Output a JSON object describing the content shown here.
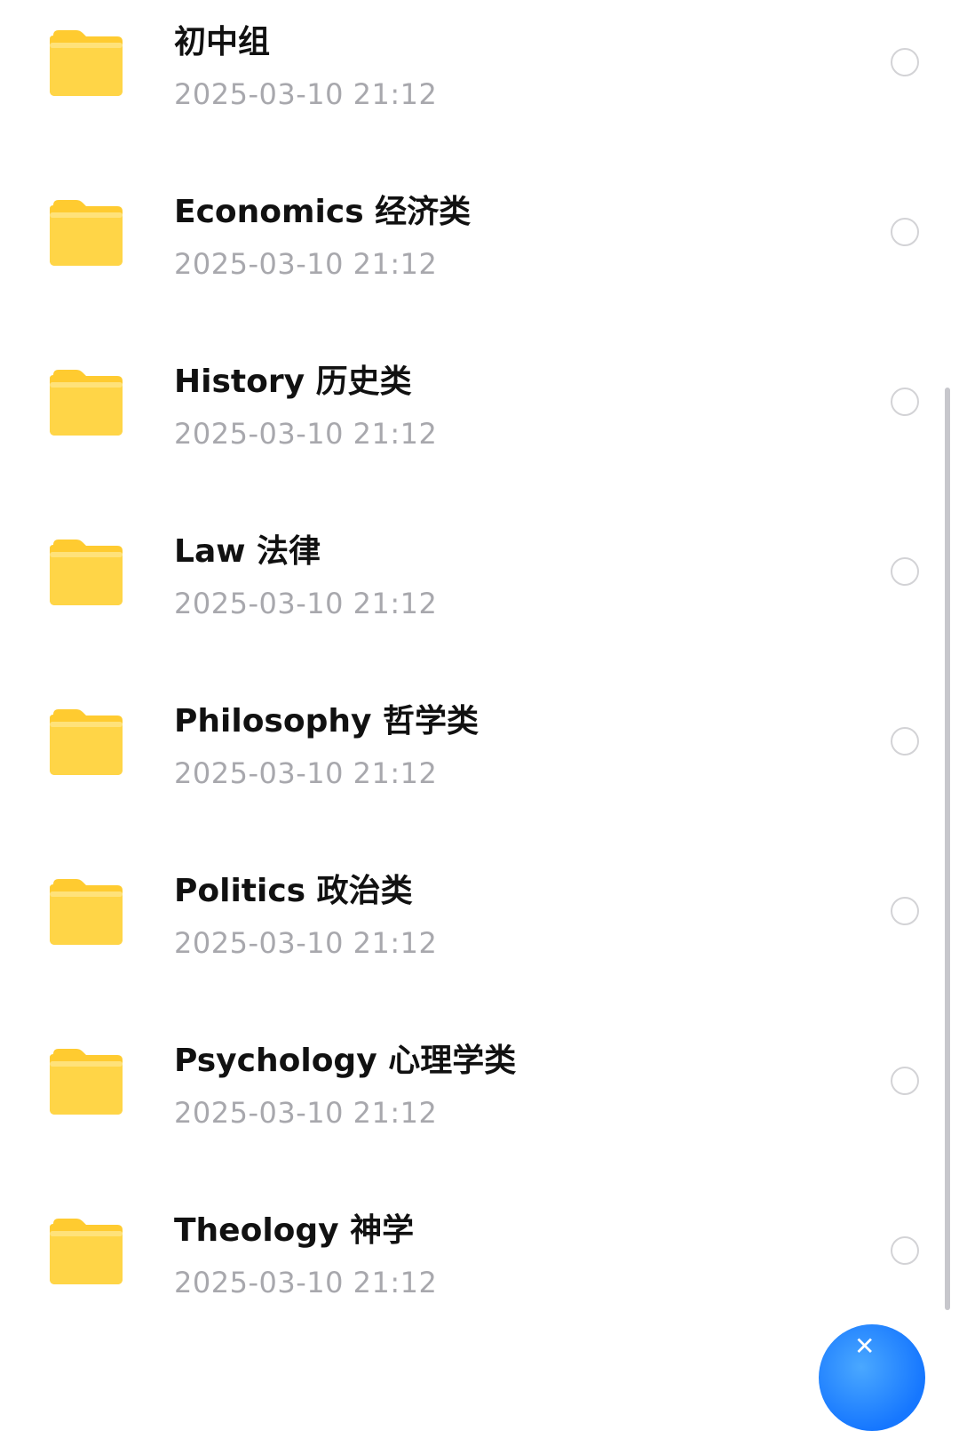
{
  "colors": {
    "folder": "#ffce3c",
    "folder_top": "#ffdd6b",
    "title_text": "#111111",
    "date_text": "#a8a8ad",
    "radio_border": "#d3d3d6",
    "scrollbar": "#c7c7cc",
    "fab": "#1677ff"
  },
  "icons": {
    "folder": "folder-icon",
    "select": "radio-circle-icon"
  },
  "folders": [
    {
      "name": "初中组",
      "date": "2025-03-10 21:12"
    },
    {
      "name": "Economics 经济类",
      "date": "2025-03-10 21:12"
    },
    {
      "name": "History 历史类",
      "date": "2025-03-10 21:12"
    },
    {
      "name": "Law 法律",
      "date": "2025-03-10 21:12"
    },
    {
      "name": "Philosophy 哲学类",
      "date": "2025-03-10 21:12"
    },
    {
      "name": "Politics 政治类",
      "date": "2025-03-10 21:12"
    },
    {
      "name": "Psychology 心理学类",
      "date": "2025-03-10 21:12"
    },
    {
      "name": "Theology 神学",
      "date": "2025-03-10 21:12"
    }
  ]
}
